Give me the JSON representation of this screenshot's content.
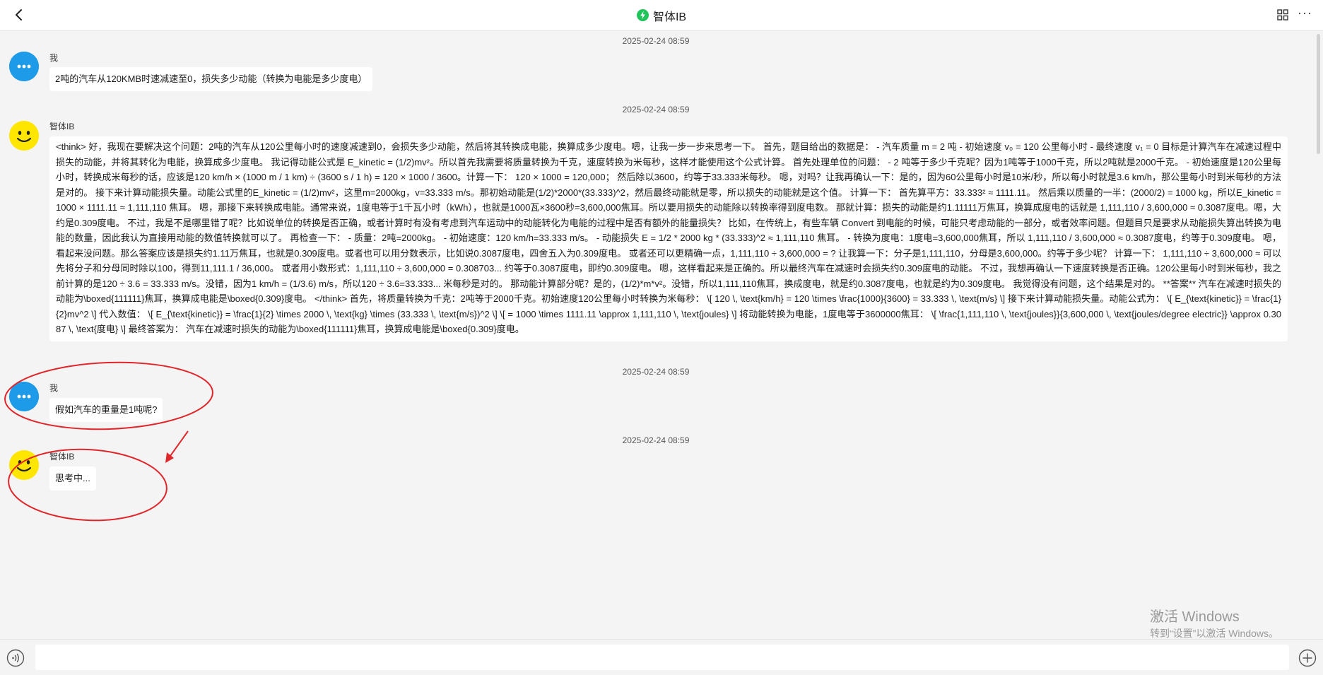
{
  "header": {
    "title": "智体IB",
    "back_icon": "chevron-left-icon",
    "title_icon": "bolt-badge-icon",
    "grid_icon": "grid-apps-icon",
    "more_icon": "more-dots-icon",
    "more_glyph": "···",
    "accent_color": "#21c45a"
  },
  "messages": [
    {
      "timestamp": "2025-02-24 08:59",
      "sender": "我",
      "avatar": "chat-bubble-icon",
      "text": "2吨的汽车从120KMB时速减速至0，损失多少动能（转换为电能是多少度电）"
    },
    {
      "timestamp": "2025-02-24 08:59",
      "sender": "智体IB",
      "avatar": "smiley-face-icon",
      "text": "<think> 好，我现在要解决这个问题：2吨的汽车从120公里每小时的速度减速到0，会损失多少动能，然后将其转换成电能，换算成多少度电。嗯，让我一步一步来思考一下。 首先，题目给出的数据是： - 汽车质量 m = 2 吨 - 初始速度 v₀ = 120 公里每小时 - 最终速度 v₁ = 0 目标是计算汽车在减速过程中损失的动能，并将其转化为电能，换算成多少度电。 我记得动能公式是 E_kinetic = (1/2)mv²。所以首先我需要将质量转换为千克，速度转换为米每秒，这样才能使用这个公式计算。 首先处理单位的问题： - 2 吨等于多少千克呢？因为1吨等于1000千克，所以2吨就是2000千克。 - 初始速度是120公里每小时，转换成米每秒的话，应该是120 km/h × (1000 m / 1 km) ÷ (3600 s / 1 h) = 120 × 1000 / 3600。计算一下： 120 × 1000 = 120,000； 然后除以3600，约等于33.333米每秒。 嗯，对吗？让我再确认一下：是的，因为60公里每小时是10米/秒，所以每小时就是3.6 km/h，那公里每小时到米每秒的方法是对的。 接下来计算动能损失量。动能公式里的E_kinetic = (1/2)mv²，这里m=2000kg，v=33.333 m/s。那初始动能是(1/2)*2000*(33.333)^2，然后最终动能就是零，所以损失的动能就是这个值。 计算一下： 首先算平方：33.333² ≈ 1111.11。 然后乘以质量的一半：(2000/2) = 1000 kg，所以E_kinetic = 1000 × 1111.11 ≈ 1,111,110 焦耳。 嗯，那接下来转换成电能。通常来说，1度电等于1千瓦小时（kWh），也就是1000瓦×3600秒=3,600,000焦耳。所以要用损失的动能除以转换率得到度电数。 那就计算：损失的动能是约1.11111万焦耳，换算成度电的话就是 1,111,110 / 3,600,000 ≈ 0.3087度电。嗯，大约是0.309度电。 不过，我是不是哪里错了呢？比如说单位的转换是否正确，或者计算时有没有考虑到汽车运动中的动能转化为电能的过程中是否有额外的能量损失？ 比如，在传统上，有些车辆 Convert 到电能的时候，可能只考虑动能的一部分，或者效率问题。但题目只是要求从动能损失算出转换为电能的数量，因此我认为直接用动能的数值转换就可以了。 再检查一下： - 质量：2吨=2000kg。 - 初始速度：120 km/h=33.333 m/s。 - 动能损失 E = 1/2 * 2000 kg * (33.333)^2 ≈ 1,111,110 焦耳。 - 转换为度电：1度电=3,600,000焦耳，所以 1,111,110 / 3,600,000 ≈ 0.3087度电，约等于0.309度电。 嗯，看起来没问题。那么答案应该是损失约1.11万焦耳，也就是0.309度电。或者也可以用分数表示，比如说0.3087度电，四舍五入为0.309度电。 或者还可以更精确一点，1,111,110 ÷ 3,600,000 = ? 让我算一下：分子是1,111,110，分母是3,600,000。约等于多少呢？ 计算一下： 1,111,110 ÷ 3,600,000 ≈ 可以先将分子和分母同时除以100，得到11,111.1 / 36,000。 或者用小数形式：1,111,110 ÷ 3,600,000 = 0.308703... 约等于0.3087度电，即约0.309度电。 嗯，这样看起来是正确的。所以最终汽车在减速时会损失约0.309度电的动能。 不过，我想再确认一下速度转换是否正确。120公里每小时到米每秒，我之前计算的是120 ÷ 3.6 = 33.333 m/s。没错，因为1 km/h = (1/3.6) m/s，所以120 ÷ 3.6=33.333... 米每秒是对的。 那动能计算部分呢？是的，(1/2)*m*v²。没错，所以1,111,110焦耳，换成度电，就是约0.3087度电，也就是约为0.309度电。 我觉得没有问题，这个结果是对的。 **答案** 汽车在减速时损失的动能为\\boxed{111111}焦耳，换算成电能是\\boxed{0.309}度电。 </think> 首先，将质量转换为千克：2吨等于2000千克。初始速度120公里每小时转换为米每秒： \\[ 120 \\, \\text{km/h} = 120 \\times \\frac{1000}{3600} = 33.333 \\, \\text{m/s} \\] 接下来计算动能损失量。动能公式为： \\[ E_{\\text{kinetic}} = \\frac{1}{2}mv^2 \\] 代入数值： \\[ E_{\\text{kinetic}} = \\frac{1}{2} \\times 2000 \\, \\text{kg} \\times (33.333 \\, \\text{m/s})^2 \\] \\[ = 1000 \\times 1111.11 \\approx 1,111,110 \\, \\text{joules} \\] 将动能转换为电能，1度电等于3600000焦耳： \\[ \\frac{1,111,110 \\, \\text{joules}}{3,600,000 \\, \\text{joules/degree electric}} \\approx 0.3087 \\, \\text{度电} \\] 最终答案为： 汽车在减速时损失的动能为\\boxed{111111}焦耳，换算成电能是\\boxed{0.309}度电。"
    },
    {
      "timestamp": "2025-02-24 08:59",
      "sender": "我",
      "avatar": "chat-bubble-icon",
      "text": "假如汽车的重量是1吨呢?"
    },
    {
      "timestamp": "2025-02-24 08:59",
      "sender": "智体IB",
      "avatar": "smiley-face-icon",
      "text": "思考中..."
    }
  ],
  "annotation": {
    "color": "#e0262a",
    "shapes": [
      "ellipse",
      "ellipse",
      "arrow"
    ]
  },
  "watermark": {
    "line1": "激活 Windows",
    "line2": "转到“设置”以激活 Windows。"
  },
  "input": {
    "value": "",
    "placeholder": "",
    "voice_icon": "voice-waves-icon",
    "add_icon": "plus-circle-icon"
  },
  "colors": {
    "user_avatar": "#1e9be8",
    "bot_avatar": "#ffe600",
    "background": "#f4f4f4",
    "bubble": "#ffffff"
  }
}
